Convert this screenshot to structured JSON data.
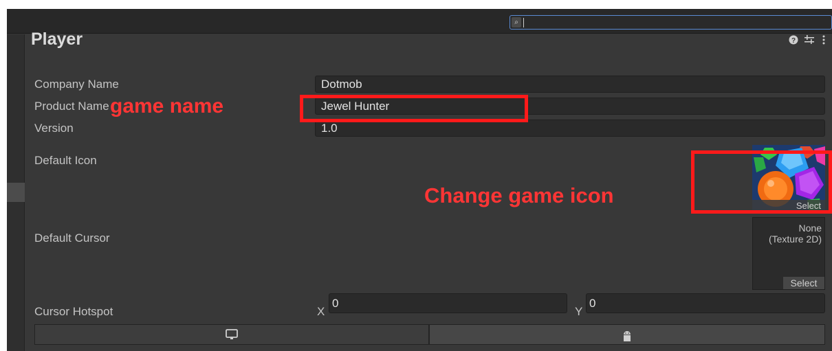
{
  "inspector": {
    "title": "Player",
    "header_icons": [
      "help-icon",
      "settings-sliders-icon",
      "more-menu-icon"
    ]
  },
  "search": {
    "icon": "search-icon",
    "value": ""
  },
  "fields": {
    "company_name_label": "Company Name",
    "company_name_value": "Dotmob",
    "product_name_label": "Product Name",
    "product_name_value": "Jewel Hunter",
    "version_label": "Version",
    "version_value": "1.0",
    "default_icon_label": "Default Icon",
    "default_icon_select": "Select",
    "default_cursor_label": "Default Cursor",
    "default_cursor_value_line1": "None",
    "default_cursor_value_line2": "(Texture 2D)",
    "default_cursor_select": "Select",
    "cursor_hotspot_label": "Cursor Hotspot",
    "hotspot_x_label": "X",
    "hotspot_x_value": "0",
    "hotspot_y_label": "Y",
    "hotspot_y_value": "0"
  },
  "platform_tabs": [
    {
      "icon": "desktop-icon",
      "active": false
    },
    {
      "icon": "android-icon",
      "active": true
    }
  ],
  "annotations": {
    "game_name": "game name",
    "change_icon": "Change game icon",
    "color": "#ff2020"
  },
  "colors": {
    "panel_bg": "#383838",
    "field_bg": "#2a2a2a",
    "text": "#c4c4c4",
    "search_border": "#5b8bd4"
  }
}
